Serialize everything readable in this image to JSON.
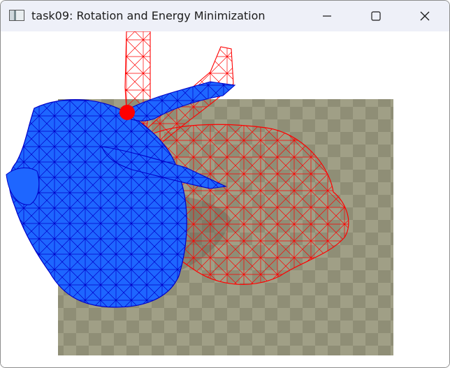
{
  "window": {
    "title": "task09: Rotation and Energy Minimization",
    "app_icon": "application-window-icon"
  },
  "controls": {
    "minimize_icon": "minimize-icon",
    "maximize_icon": "maximize-icon",
    "close_icon": "close-icon"
  },
  "scene": {
    "background": "#ffffff",
    "floor_colors": [
      "#8f8e76",
      "#a09f86"
    ],
    "deformed_mesh_color": "#1e66ff",
    "deformed_mesh_edge_color": "#0000c8",
    "reference_wire_color": "#ff0000",
    "handle_color": "#ff0000"
  }
}
